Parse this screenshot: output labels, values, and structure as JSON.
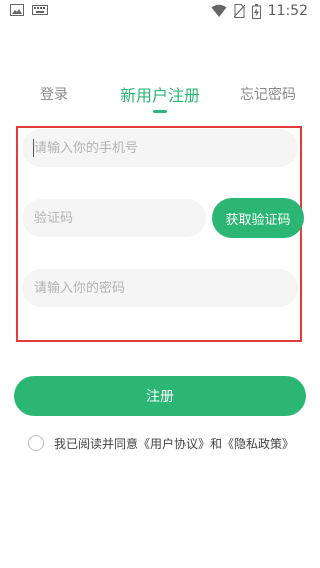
{
  "status_bar": {
    "time": "11:52",
    "icons": [
      "picture-icon",
      "keyboard-icon",
      "wifi-icon",
      "no-sim-icon",
      "battery-charging-icon"
    ]
  },
  "tabs": {
    "login": "登录",
    "register": "新用户注册",
    "forgot": "忘记密码",
    "active": "register"
  },
  "form": {
    "phone_placeholder": "请输入你的手机号",
    "code_placeholder": "验证码",
    "get_code_label": "获取验证码",
    "password_placeholder": "请输入你的密码"
  },
  "register_button": "注册",
  "agreement": {
    "text": "我已阅读并同意《用户协议》和《隐私政策》",
    "checked": false
  },
  "colors": {
    "accent": "#2bb673",
    "highlight": "#e43a3a"
  }
}
